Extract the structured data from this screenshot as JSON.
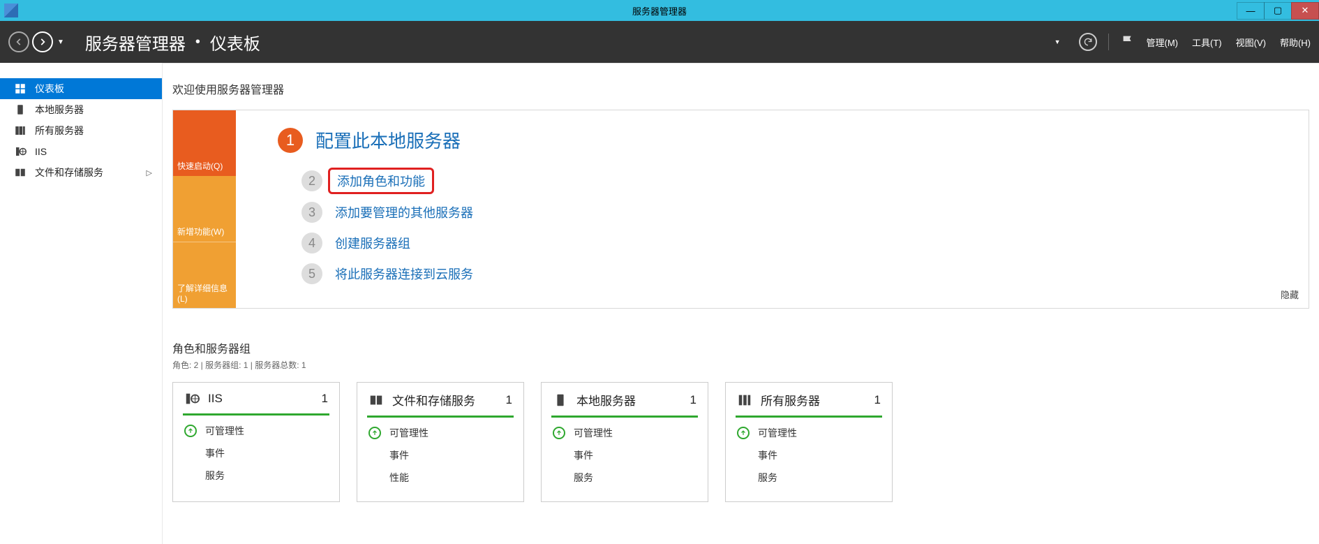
{
  "window": {
    "title": "服务器管理器"
  },
  "header": {
    "breadcrumb_app": "服务器管理器",
    "breadcrumb_page": "仪表板",
    "menu": {
      "manage": "管理(M)",
      "tools": "工具(T)",
      "view": "视图(V)",
      "help": "帮助(H)"
    }
  },
  "sidebar": {
    "items": [
      {
        "label": "仪表板",
        "icon": "dashboard",
        "active": true
      },
      {
        "label": "本地服务器",
        "icon": "local-server"
      },
      {
        "label": "所有服务器",
        "icon": "all-servers"
      },
      {
        "label": "IIS",
        "icon": "iis"
      },
      {
        "label": "文件和存储服务",
        "icon": "storage",
        "expandable": true
      }
    ]
  },
  "welcome": {
    "heading": "欢迎使用服务器管理器",
    "tabs": {
      "quickstart": "快速启动(Q)",
      "whatsnew": "新增功能(W)",
      "learnmore": "了解详细信息(L)"
    },
    "steps": [
      {
        "num": "1",
        "text": "配置此本地服务器",
        "big": true
      },
      {
        "num": "2",
        "text": "添加角色和功能",
        "highlight": true
      },
      {
        "num": "3",
        "text": "添加要管理的其他服务器"
      },
      {
        "num": "4",
        "text": "创建服务器组"
      },
      {
        "num": "5",
        "text": "将此服务器连接到云服务"
      }
    ],
    "hide": "隐藏"
  },
  "roles": {
    "title": "角色和服务器组",
    "subtitle": "角色: 2 | 服务器组: 1 | 服务器总数: 1",
    "tiles": [
      {
        "name": "IIS",
        "count": "1",
        "icon": "iis",
        "rows": [
          "可管理性",
          "事件",
          "服务"
        ]
      },
      {
        "name": "文件和存储服务",
        "count": "1",
        "icon": "storage",
        "rows": [
          "可管理性",
          "事件",
          "性能"
        ]
      },
      {
        "name": "本地服务器",
        "count": "1",
        "icon": "local-server",
        "rows": [
          "可管理性",
          "事件",
          "服务"
        ]
      },
      {
        "name": "所有服务器",
        "count": "1",
        "icon": "all-servers",
        "rows": [
          "可管理性",
          "事件",
          "服务"
        ]
      }
    ]
  }
}
